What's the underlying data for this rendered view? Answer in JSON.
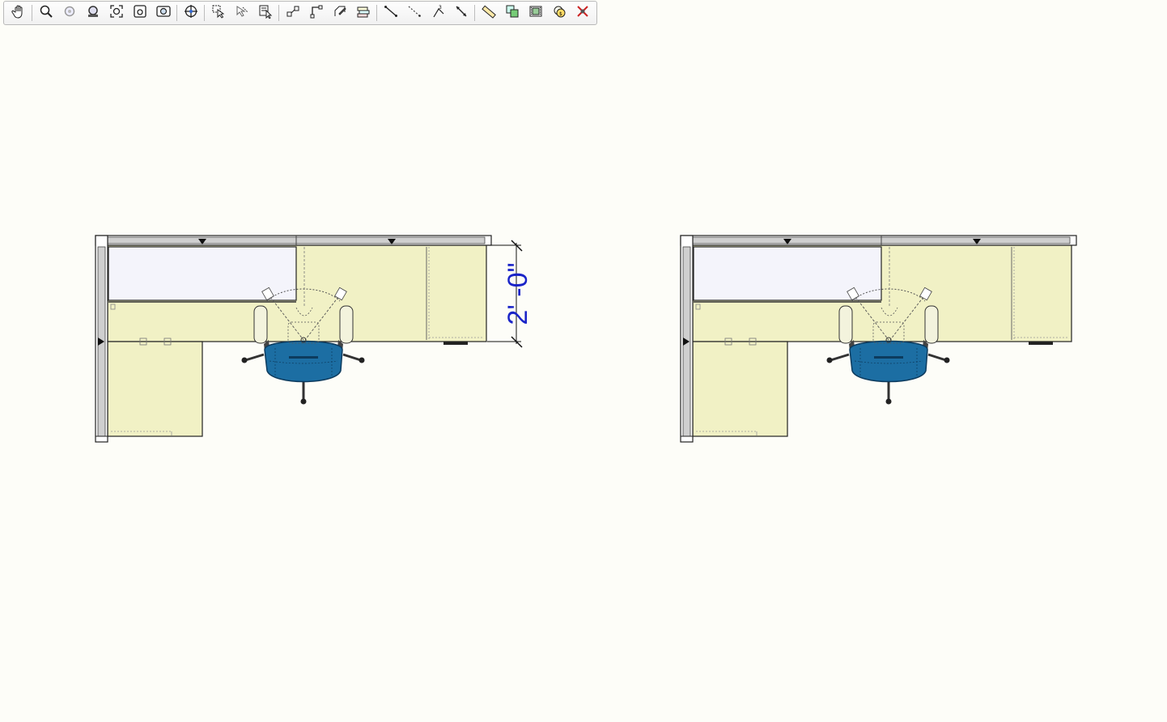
{
  "toolbar": {
    "buttons": [
      {
        "icon": "pan-hand-icon",
        "group": 1
      },
      {
        "icon": "zoom-icon",
        "group": 2
      },
      {
        "icon": "zoom-in-icon",
        "group": 2
      },
      {
        "icon": "zoom-out-icon",
        "group": 2
      },
      {
        "icon": "zoom-extents-icon",
        "group": 2
      },
      {
        "icon": "zoom-window-icon",
        "group": 2
      },
      {
        "icon": "zoom-previous-icon",
        "group": 2
      },
      {
        "icon": "target-center-icon",
        "group": 3
      },
      {
        "icon": "select-icon",
        "group": 4
      },
      {
        "icon": "select-deselect-icon",
        "group": 4
      },
      {
        "icon": "select-properties-icon",
        "group": 4
      },
      {
        "icon": "move-icon",
        "group": 5
      },
      {
        "icon": "rotate-icon",
        "group": 5
      },
      {
        "icon": "edit-shape-icon",
        "group": 5
      },
      {
        "icon": "layers-icon",
        "group": 5
      },
      {
        "icon": "line-icon",
        "group": 6
      },
      {
        "icon": "dashed-line-icon",
        "group": 6
      },
      {
        "icon": "angle-dimension-icon",
        "group": 6
      },
      {
        "icon": "dimension-icon",
        "group": 6
      },
      {
        "icon": "measure-ruler-icon",
        "group": 7
      },
      {
        "icon": "copy-icon",
        "group": 7
      },
      {
        "icon": "film-strip-icon",
        "group": 7
      },
      {
        "icon": "price-icon",
        "group": 7
      },
      {
        "icon": "delete-icon",
        "group": 7
      }
    ]
  },
  "dimension": {
    "label": "2' -0\""
  },
  "colors": {
    "background": "#fdfdf8",
    "worksurface": "#f1f1c5",
    "panel_gray": "#cfcfcf",
    "glass_panel": "#f4f4fb",
    "chair_blue": "#1c6ea3",
    "dimension_text": "#1a24c8"
  }
}
